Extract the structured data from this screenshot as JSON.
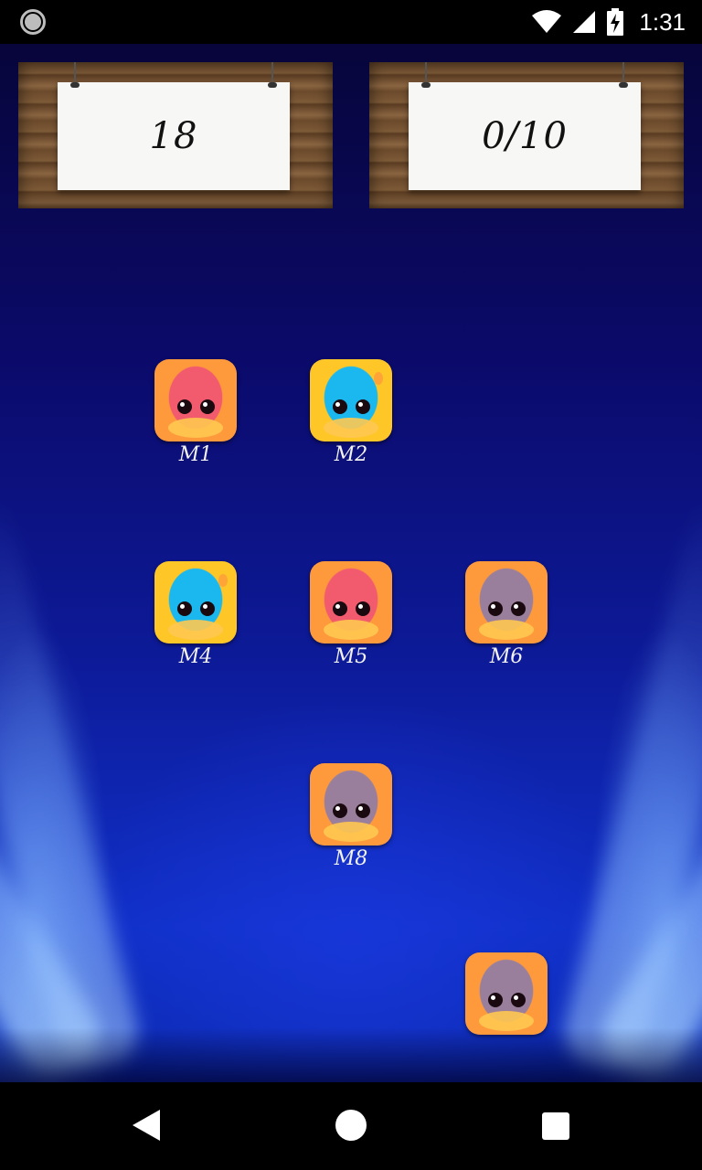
{
  "status_bar": {
    "time": "1:31",
    "icons": [
      "record-icon",
      "wifi-icon",
      "signal-icon",
      "battery-charging-icon"
    ]
  },
  "scoreboard": {
    "timer_value": "18",
    "progress_value": "0/10"
  },
  "monsters": [
    {
      "label": "M1",
      "color": "pink"
    },
    {
      "label": "M2",
      "color": "blue"
    },
    {
      "label": "M4",
      "color": "blue"
    },
    {
      "label": "M5",
      "color": "pink"
    },
    {
      "label": "M6",
      "color": "purple"
    },
    {
      "label": "M8",
      "color": "purple"
    },
    {
      "label": "",
      "color": "purple"
    }
  ],
  "colors": {
    "pink": "#f25a6e",
    "blue": "#1ab8ef",
    "purple": "#9a7f9c",
    "frame_orange": "#ff9a3c",
    "frame_yellow": "#ffc628"
  },
  "nav_bar": {
    "icons": [
      "back-icon",
      "home-icon",
      "recents-icon"
    ]
  }
}
